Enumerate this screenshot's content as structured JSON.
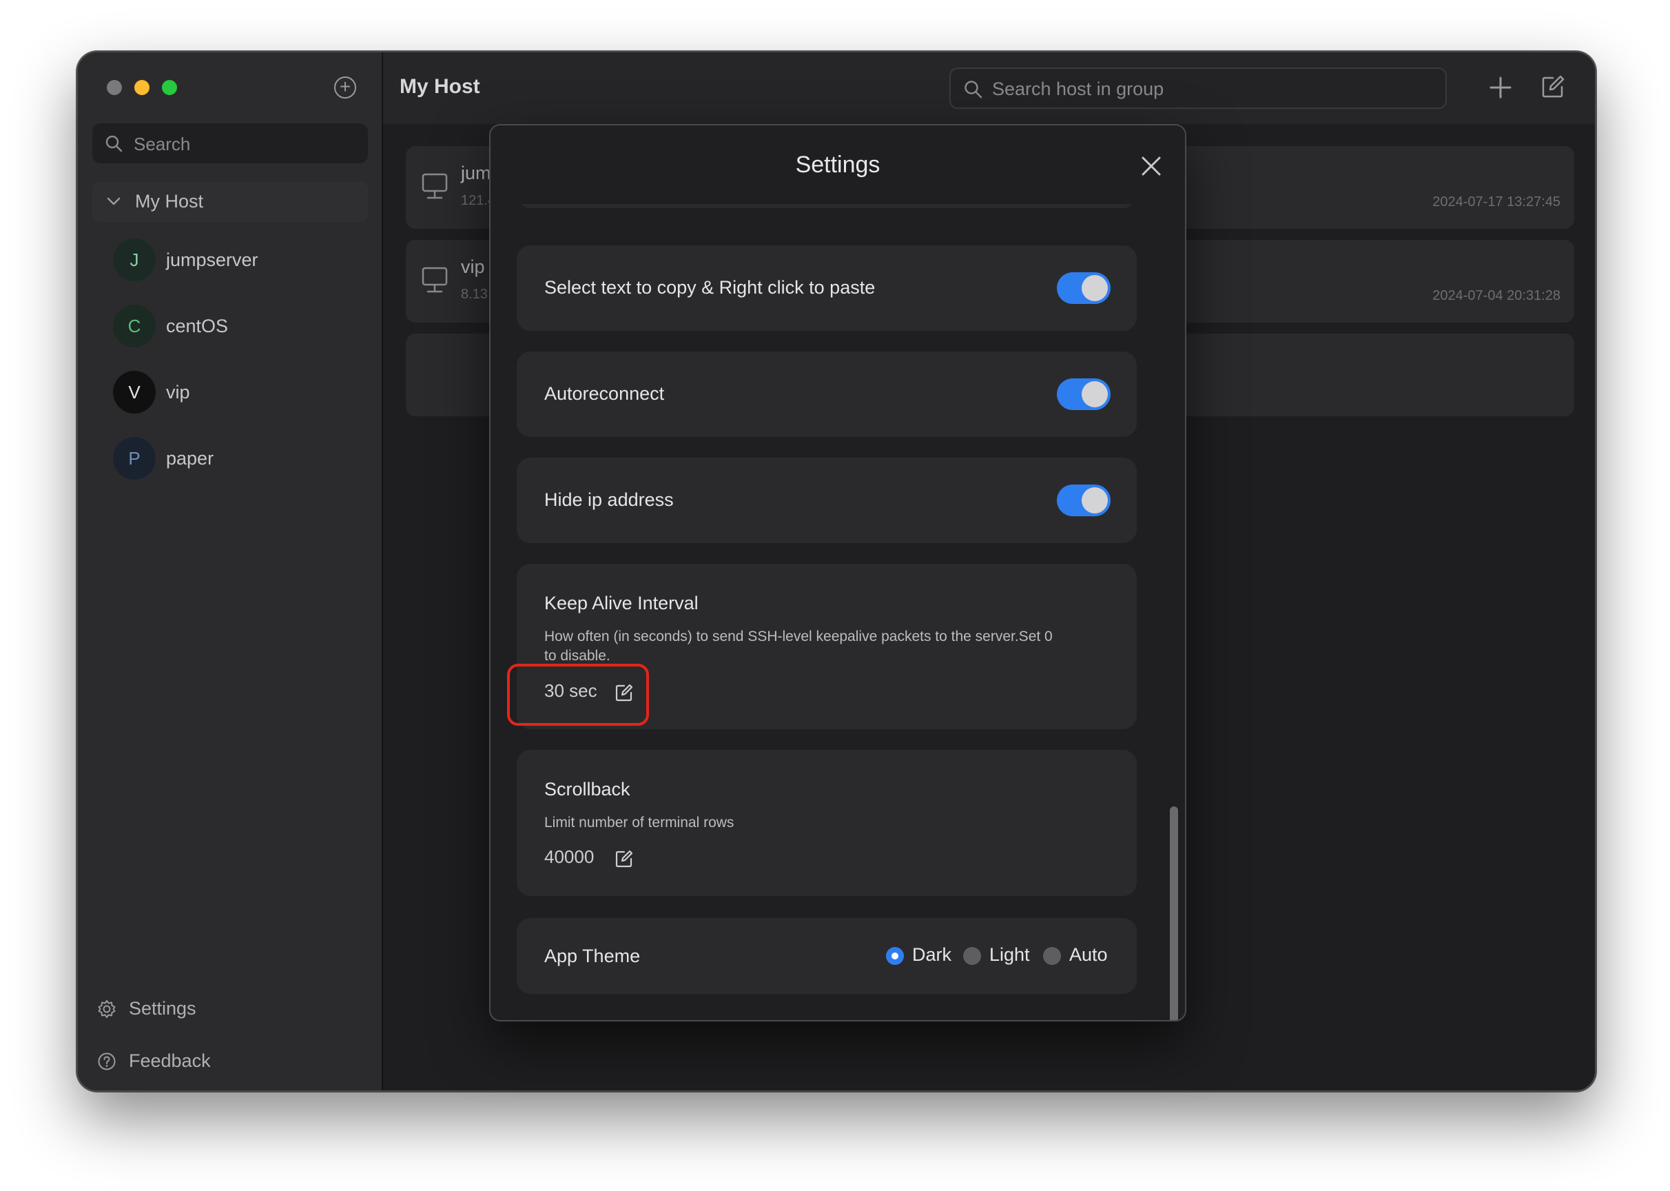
{
  "sidebar": {
    "search_placeholder": "Search",
    "group_label": "My Host",
    "hosts": [
      {
        "initial": "J",
        "name": "jumpserver",
        "color": "#8ad0a6"
      },
      {
        "initial": "C",
        "name": "centOS",
        "color": "#5ac07c"
      },
      {
        "initial": "V",
        "name": "vip",
        "color": "#e6e6e8"
      },
      {
        "initial": "P",
        "name": "paper",
        "color": "#6f8fb8"
      }
    ],
    "footer": {
      "settings_label": "Settings",
      "feedback_label": "Feedback"
    }
  },
  "main": {
    "title": "My Host",
    "search_placeholder": "Search host in group",
    "cards": [
      {
        "name": "jum",
        "ip": "121.4",
        "timestamp": "2024-07-17 13:27:45"
      },
      {
        "name": "vip",
        "ip": "8.13",
        "timestamp": "2024-07-04 20:31:28"
      }
    ]
  },
  "settings": {
    "title": "Settings",
    "select_copy_label": "Select text to copy & Right click to paste",
    "select_copy_enabled": true,
    "autoreconnect_label": "Autoreconnect",
    "autoreconnect_enabled": true,
    "hide_ip_label": "Hide ip address",
    "hide_ip_enabled": true,
    "keepalive": {
      "title": "Keep Alive Interval",
      "description": "How often (in seconds) to send SSH-level keepalive packets to the server.Set 0 to disable.",
      "value": "30 sec"
    },
    "scrollback": {
      "title": "Scrollback",
      "description": "Limit number of terminal rows",
      "value": "40000"
    },
    "theme": {
      "label": "App Theme",
      "options": [
        "Dark",
        "Light",
        "Auto"
      ],
      "selected": "Dark"
    }
  },
  "colors": {
    "accent": "#2f7ef0",
    "highlight": "#e5251a"
  }
}
